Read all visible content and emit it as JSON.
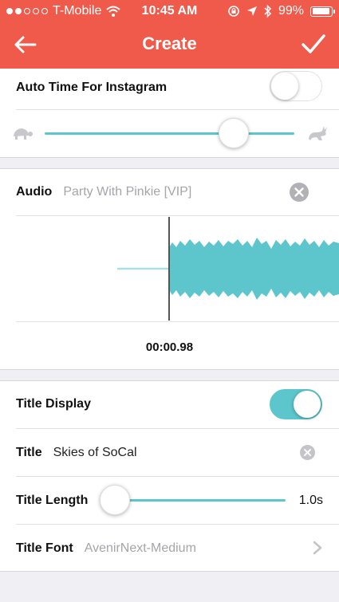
{
  "status_bar": {
    "carrier": "T-Mobile",
    "signal_dots_filled": 2,
    "signal_dots_total": 5,
    "time": "10:45 AM",
    "battery": "99%"
  },
  "nav": {
    "title": "Create",
    "back_icon": "arrow-left-icon",
    "done_icon": "checkmark-icon"
  },
  "auto_time": {
    "label": "Auto Time For Instagram",
    "enabled": false,
    "speed_value": 0.69,
    "slow_icon": "turtle-icon",
    "fast_icon": "rabbit-icon"
  },
  "audio": {
    "label": "Audio",
    "track": "Party With Pinkie [VIP]",
    "playhead_time": "00:00.98"
  },
  "title_settings": {
    "display_label": "Title Display",
    "display_enabled": true,
    "title_label": "Title",
    "title_value": "Skies of SoCal",
    "length_label": "Title Length",
    "length_value": "1.0s",
    "length_fraction": 0.0,
    "font_label": "Title Font",
    "font_value": "AvenirNext-Medium"
  },
  "colors": {
    "header": "#ef5a4a",
    "accent": "#5cc6cc"
  }
}
